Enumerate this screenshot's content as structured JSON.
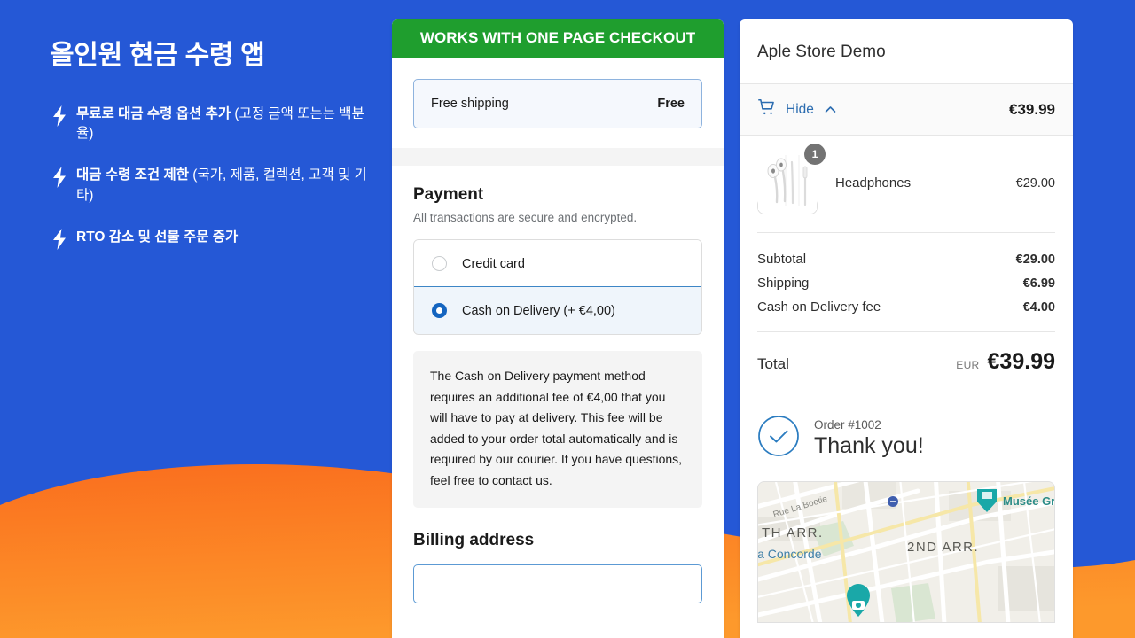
{
  "theme": {
    "background_blue": "#2558D6",
    "accent_orange": "#FB8B24",
    "banner_green": "#1F9E2E",
    "link_blue": "#2B6CB0",
    "radio_selected_blue": "#1565C0"
  },
  "promo": {
    "title": "올인원 현금 수령 앱",
    "bullets": [
      {
        "bold": "무료로 대금 수령 옵션 추가",
        "rest": " (고정 금액 또는는 백분율)"
      },
      {
        "bold": "대금 수령 조건 제한",
        "rest": " (국가, 제품, 컬렉션, 고객 및 기타)"
      },
      {
        "bold": "RTO 감소 및 선불 주문 증가",
        "rest": ""
      }
    ],
    "bullet_icon": "bolt-icon"
  },
  "checkout": {
    "banner": "WORKS WITH ONE PAGE CHECKOUT",
    "shipping": {
      "label": "Free shipping",
      "value": "Free"
    },
    "payment": {
      "title": "Payment",
      "subtitle": "All transactions are secure and encrypted.",
      "options": [
        {
          "label": "Credit card",
          "selected": false
        },
        {
          "label": "Cash on Delivery (+ €4,00)",
          "selected": true
        }
      ],
      "info": "The Cash on Delivery payment method requires an additional fee of €4,00 that you will have to pay at delivery. This fee will be added to your order total automatically and is required by our courier. If you have questions, feel free to contact us."
    },
    "billing": {
      "title": "Billing address",
      "field_value": ""
    }
  },
  "summary": {
    "store_name": "Aple Store Demo",
    "cart_bar": {
      "icon": "shopping-cart-icon",
      "toggle_label": "Hide",
      "toggle_chevron": "chevron-up-icon",
      "amount": "€39.99"
    },
    "items": [
      {
        "name": "Headphones",
        "price": "€29.00",
        "quantity": "1",
        "thumbnail": "earbuds-product-image"
      }
    ],
    "totals": [
      {
        "label": "Subtotal",
        "value": "€29.00"
      },
      {
        "label": "Shipping",
        "value": "€6.99"
      },
      {
        "label": "Cash on Delivery fee",
        "value": "€4.00"
      }
    ],
    "grand_total": {
      "label": "Total",
      "currency": "EUR",
      "value": "€39.99"
    },
    "confirmation": {
      "icon": "check-circle-icon",
      "order_number": "Order #1002",
      "heading": "Thank you!"
    },
    "map": {
      "labels": [
        "Rue La Boetie",
        "Musée Grévin",
        "TH ARR.",
        "la Concorde",
        "2ND ARR."
      ],
      "markers": [
        "museum-pin",
        "metro-dot",
        "camera-pin"
      ]
    }
  }
}
